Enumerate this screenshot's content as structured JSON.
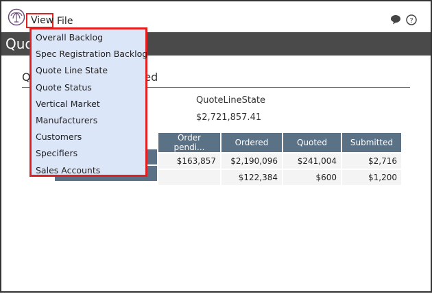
{
  "menubar": {
    "view_label": "View",
    "file_label": "File"
  },
  "header": {
    "title": "Quo"
  },
  "section": {
    "title_left": "Q",
    "title_right": "red"
  },
  "metric": {
    "label": "QuoteLineState",
    "value": "$2,721,857.41"
  },
  "table": {
    "columns": [
      "Order pendi...",
      "Ordered",
      "Quoted",
      "Submitted"
    ],
    "rows": [
      {
        "label": "",
        "cells": [
          "$163,857",
          "$2,190,096",
          "$241,004",
          "$2,716"
        ]
      },
      {
        "label": "",
        "cells": [
          "",
          "$122,384",
          "$600",
          "$1,200"
        ]
      }
    ]
  },
  "view_menu": {
    "items": [
      "Overall Backlog",
      "Spec Registration Backlog",
      "Quote Line State",
      "Quote Status",
      "Vertical Market",
      "Manufacturers",
      "Customers",
      "Specifiers",
      "Sales Accounts"
    ]
  },
  "icons": {
    "logo": "palm-tree-logo",
    "chat": "chat-bubble-icon",
    "help": "help-circle-icon"
  },
  "colors": {
    "titlebar": "#4a4a4a",
    "table_header": "#5b7185",
    "menu_bg": "#dce6f9",
    "highlight_border": "#e02020"
  }
}
